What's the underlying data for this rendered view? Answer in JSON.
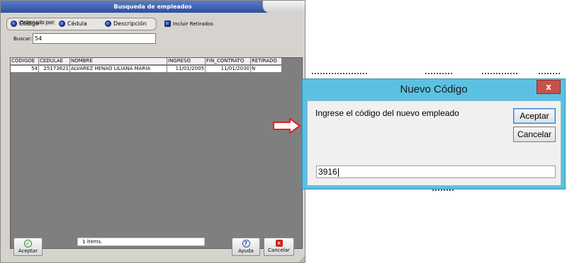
{
  "busqueda": {
    "title": "Busqueda de empleados",
    "ordenado_por": {
      "legend": "Ordenado por",
      "options": [
        "Código",
        "Cédula",
        "Descripción"
      ]
    },
    "incluir_retirados": "Incluir Retirados",
    "buscar_label": "Buscar:",
    "buscar_value": "54",
    "grid": {
      "columns": [
        "CODIGOE",
        "CEDULAE",
        "NOMBRE",
        "INGRESO",
        "FIN_CONTRATO",
        "RETIRADO"
      ],
      "rows": [
        [
          "54",
          "25173621",
          "ALVAREZ HENAO LILIANA MARIA",
          "11/01/2005",
          "11/01/2030",
          "N"
        ]
      ]
    },
    "items_text": "1 items.",
    "buttons": {
      "aceptar": "Aceptar",
      "ayuda": "Ayuda",
      "cancelar": "Cancelar"
    }
  },
  "dialog": {
    "title": "Nuevo Código",
    "message": "Ingrese el código del nuevo empleado",
    "aceptar": "Aceptar",
    "cancelar": "Cancelar",
    "input_value": "3916",
    "close_glyph": "x"
  },
  "colors": {
    "dialog_frame": "#5bc1e2",
    "title_bar": "#2b4f9e",
    "grid_background": "#7f7f7f",
    "close_button": "#c7514b",
    "arrow": "#e02020"
  }
}
